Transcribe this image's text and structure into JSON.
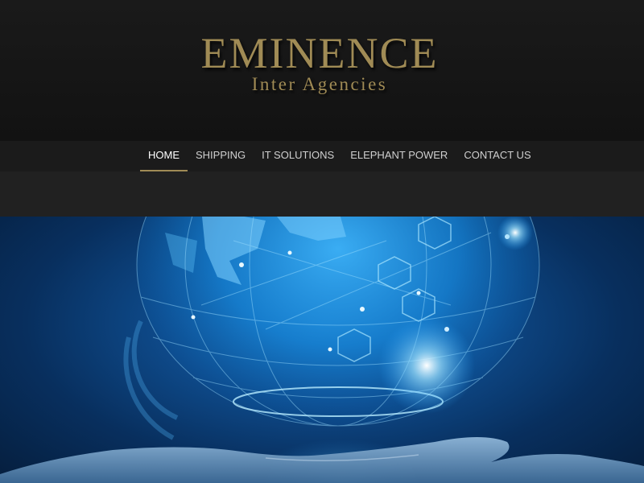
{
  "logo": {
    "main": "EMINENCE",
    "sub": "Inter Agencies"
  },
  "nav": {
    "items": [
      {
        "label": "HOME",
        "active": true
      },
      {
        "label": "SHIPPING",
        "active": false
      },
      {
        "label": "IT SOLUTIONS",
        "active": false
      },
      {
        "label": "ELEPHANT POWER",
        "active": false
      },
      {
        "label": "CONTACT US",
        "active": false
      }
    ]
  },
  "colors": {
    "accent_gold": "#a08b55",
    "header_bg": "#161616",
    "hero_blue": "#0e4a8a"
  }
}
